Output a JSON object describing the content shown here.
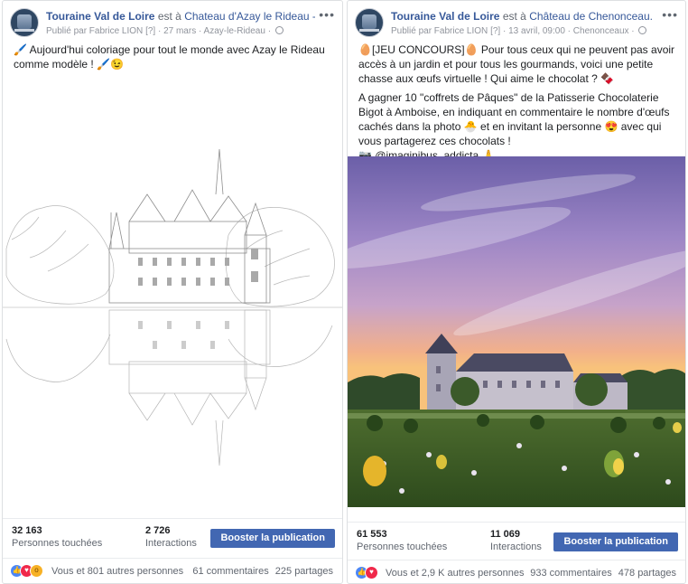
{
  "posts": [
    {
      "page_name": "Touraine Val de Loire",
      "at_text": "est à",
      "place": "Chateau d'Azay le Rideau - officiel.",
      "meta_prefix": "Publié par Fabrice LION",
      "meta_bracket": "[?]",
      "date": "27 mars",
      "location": "Azay-le-Rideau",
      "more_label": "•••",
      "text_lines": [
        "🖌️ Aujourd'hui coloriage pour tout le monde avec Azay le Rideau comme modèle ! 🖌️😉"
      ],
      "reach_value": "32 163",
      "reach_label": "Personnes touchées",
      "interactions_value": "2 726",
      "interactions_label": "Interactions",
      "boost_label": "Booster la publication",
      "reactions_text": "Vous et 801 autres personnes",
      "comments": "61 commentaires",
      "shares": "225 partages",
      "reaction_icons": [
        "like-icon",
        "love-icon",
        "wow-icon"
      ]
    },
    {
      "page_name": "Touraine Val de Loire",
      "at_text": "est à",
      "place": "Château de Chenonceau.",
      "meta_prefix": "Publié par Fabrice LION",
      "meta_bracket": "[?]",
      "date": "13 avril, 09:00",
      "location": "Chenonceaux",
      "more_label": "•••",
      "text_p1": "🥚[JEU CONCOURS]🥚 Pour tous ceux qui ne peuvent pas avoir accès à un jardin et pour tous les gourmands, voici une petite chasse aux œufs virtuelle ! Qui aime le chocolat ? 🍫",
      "text_p2": "A gagner 10 \"coffrets de Pâques\" de la Patisserie Chocolaterie Bigot à Amboise, en indiquant en commentaire le nombre d'œufs cachés dans la photo 🐣 et en invitant la personne 😍 avec qui vous partagerez ces chocolats !",
      "text_p3": "📷 @imaginibus_addicta 🙏",
      "reach_value": "61 553",
      "reach_label": "Personnes touchées",
      "interactions_value": "11 069",
      "interactions_label": "Interactions",
      "boost_label": "Booster la publication",
      "reactions_text": "Vous et 2,9 K autres personnes",
      "comments": "933 commentaires",
      "shares": "478 partages",
      "reaction_icons": [
        "like-icon",
        "love-icon"
      ]
    }
  ],
  "colors": {
    "link": "#365899",
    "boost_button": "#4267b2",
    "like": "#4c87f6",
    "love": "#f0284a",
    "wow": "#f7b125"
  }
}
